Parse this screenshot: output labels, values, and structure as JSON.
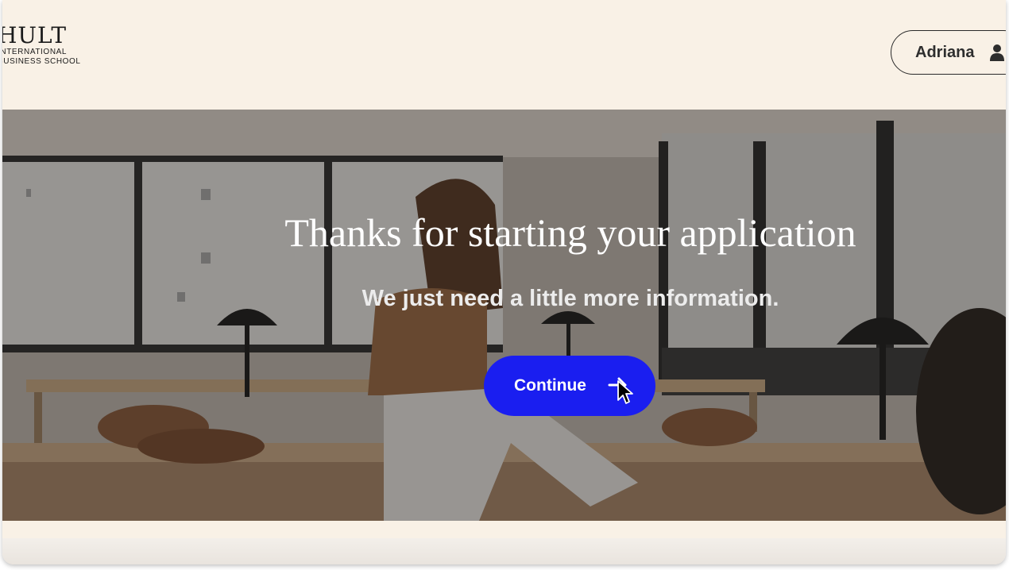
{
  "header": {
    "logo": {
      "wordmark": "HULT",
      "line1": "INTERNATIONAL",
      "line2": "BUSINESS SCHOOL"
    },
    "user": {
      "name": "Adriana",
      "icon": "user-icon"
    }
  },
  "hero": {
    "title": "Thanks for starting your application",
    "subtitle": "We just need a little more information.",
    "continue_label": "Continue",
    "continue_icon": "arrow-right-icon"
  },
  "colors": {
    "background": "#f9f1e6",
    "accent": "#1a1ef0"
  }
}
